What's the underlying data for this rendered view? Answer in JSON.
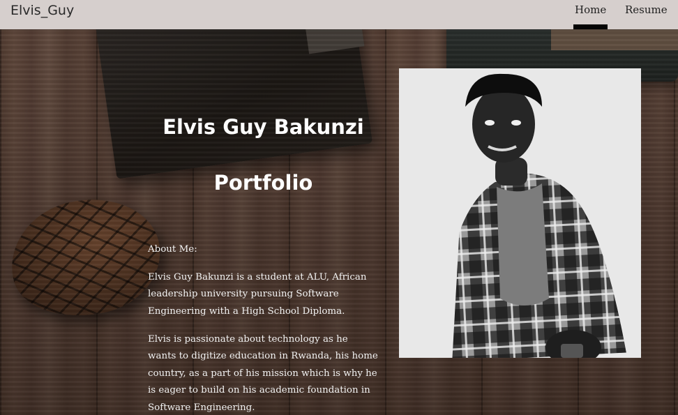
{
  "navbar": {
    "brand": "Elvis_Guy",
    "links": [
      {
        "label": "Home",
        "active": true
      },
      {
        "label": "Resume",
        "active": false
      }
    ]
  },
  "hero": {
    "name": "Elvis Guy Bakunzi",
    "subtitle": "Portfolio"
  },
  "about": {
    "label": "About Me:",
    "paragraphs": [
      "Elvis Guy Bakunzi is a student at ALU, African leadership university pursuing Software Engineering with a High School Diploma.",
      "Elvis is passionate about technology as he wants to digitize education in Rwanda, his home country, as a part of his mission which is why he is eager to build on his academic foundation in Software Engineering."
    ]
  },
  "colors": {
    "navbar_bg": "#d6cfcd",
    "active_indicator": "#050505",
    "hero_text": "#ffffff"
  }
}
